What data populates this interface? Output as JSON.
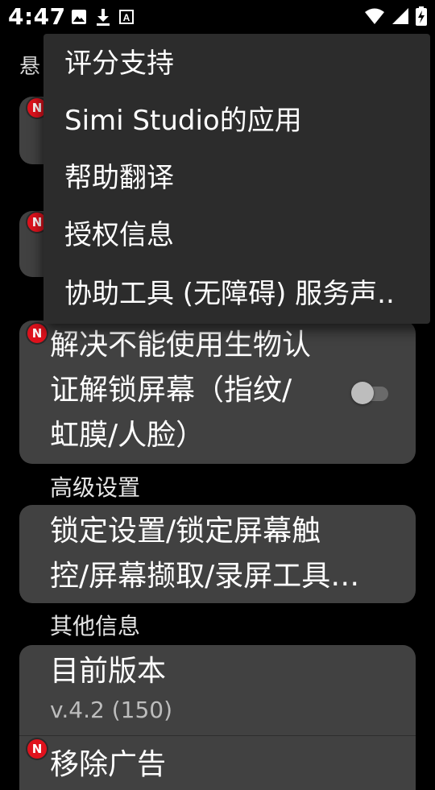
{
  "status_bar": {
    "time": "4:47",
    "left_icons": [
      "image-icon",
      "download-icon",
      "keyboard-a-icon"
    ],
    "right_icons": [
      "wifi-icon",
      "signal-icon",
      "battery-charging-icon"
    ]
  },
  "background": {
    "top_section_title_visible": "悬",
    "card3": {
      "line1": "解决不能使用生物认",
      "line2": "证解锁屏幕（指纹/",
      "line3": "虹膜/人脸）",
      "toggle_on": false
    },
    "section_advanced": "高级设置",
    "card4": {
      "line1": "锁定设置/锁定屏幕触",
      "line2": "控/屏幕撷取/录屏工具…"
    },
    "section_other": "其他信息",
    "version_card": {
      "title": "目前版本",
      "value": "v.4.2 (150)"
    },
    "remove_ads_partial": "移除广告",
    "badge_letter": "N"
  },
  "menu": {
    "items": [
      "评分支持",
      "Simi Studio的应用",
      "帮助翻译",
      "授权信息",
      "协助工具 (无障碍) 服务声.."
    ]
  },
  "colors": {
    "background": "#000000",
    "card": "#414141",
    "menu": "#2c2c2c",
    "badge": "#e0121d"
  }
}
